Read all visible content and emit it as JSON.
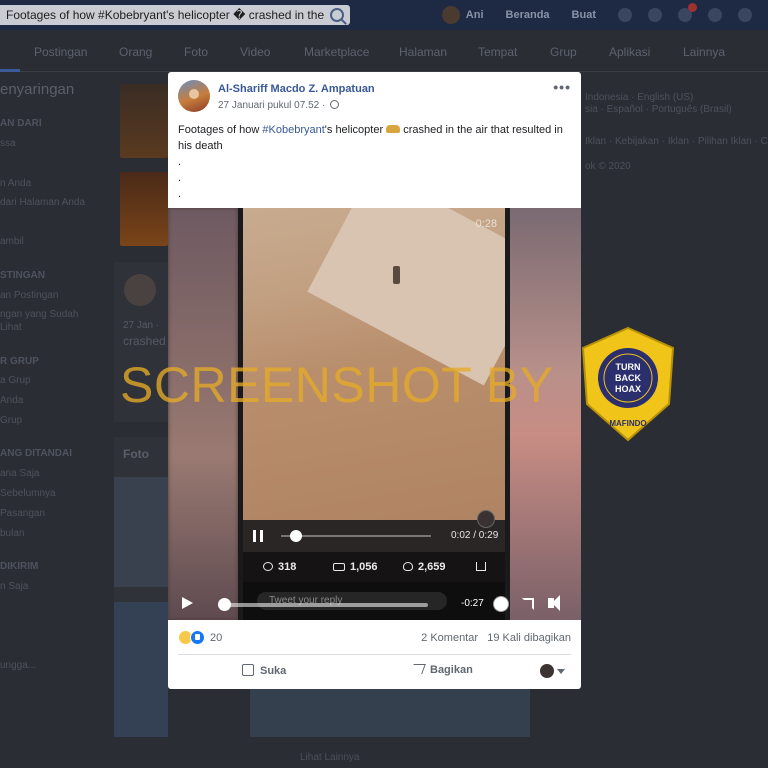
{
  "topbar": {
    "search_value": "Footages of how #Kobebryant's helicopter � crashed in the",
    "user_name": "Ani",
    "link_home": "Beranda",
    "link_create": "Buat"
  },
  "nav": {
    "items": [
      "Postingan",
      "Orang",
      "Foto",
      "Video",
      "Marketplace",
      "Halaman",
      "Tempat",
      "Grup",
      "Aplikasi",
      "Lainnya"
    ]
  },
  "left": {
    "title": "enyaringan",
    "rows": [
      "AN DARI",
      "ssa",
      "n Anda",
      "dari Halaman Anda",
      "ambil",
      "STINGAN",
      "an Postingan",
      "ngan yang Sudah",
      "Lihat",
      "R GRUP",
      "a Grup",
      "Anda",
      "Grup",
      "ANG DITANDAI",
      "ana Saja",
      "Sebelumnya",
      "Pasangan",
      "bulan",
      "DIKIRIM",
      "n Saja",
      "ungga..."
    ]
  },
  "background": {
    "post_date": "27 Jan ·",
    "post_snippet": "crashed",
    "photos_label": "Foto",
    "right_lines": [
      "Indonesia · English (US)",
      "sia · Español · Português (Brasil)",
      "Iklan · Kebijakan · Iklan · Pilihan Iklan · Cook",
      "ok © 2020"
    ],
    "footer": "Lihat Lainnya"
  },
  "watermark": {
    "text": "SCREENSHOT BY",
    "badge_top": "TURN",
    "badge_mid": "BACK",
    "badge_bottom": "HOAX",
    "badge_arc": "MASYARAKAT ANTI FITNAH INDONESIA",
    "badge_org": "MAFINDO",
    "colors": {
      "badge_fill": "#f0c419",
      "badge_inner": "#2b2f6e",
      "watermark": "#e6aa28"
    }
  },
  "post": {
    "author": "Al-Shariff Macdo Z. Ampatuan",
    "time": "27 Januari pukul 07.52 ·",
    "text_before": "Footages of how ",
    "hashtag": "#Kobebryant",
    "text_after": "'s helicopter ",
    "text_end": " crashed in the air that resulted in his death",
    "dots": [
      ".",
      ".",
      "."
    ],
    "video": {
      "top_timer": "0:28",
      "tw_time": "0:02 / 0:29",
      "tw_progress": 0.07,
      "comments": "318",
      "retweets": "1,056",
      "likes": "2,659",
      "reply_placeholder": "Tweet your reply",
      "fb_time": "-0:27",
      "fb_progress": 0.0
    },
    "reactions": {
      "count": "20",
      "comments": "2 Komentar",
      "shares": "19 Kali dibagikan"
    },
    "actions": {
      "like": "Suka",
      "share": "Bagikan"
    }
  }
}
